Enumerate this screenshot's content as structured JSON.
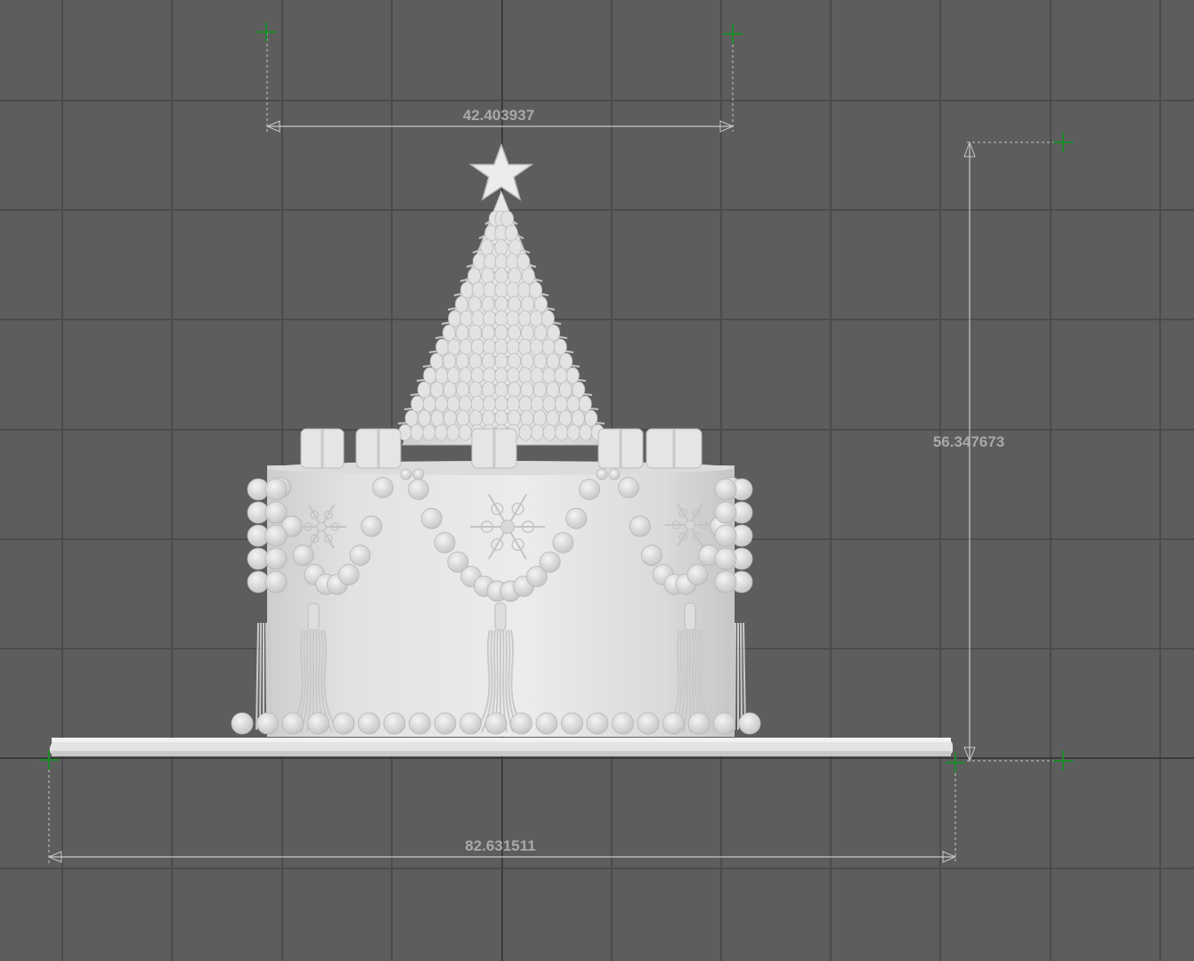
{
  "viewport": {
    "background_color": "#5d5d5d",
    "grid_line_color": "#4b4b4b",
    "axis_line_color": "#3a3a3a",
    "model_color": "#e6e6e6",
    "model_shade_color": "#cfcfcf",
    "dimension_line_color": "#c8c8c8",
    "dimension_text_color": "#a9a9a9",
    "snap_marker_color": "#1e8a2a"
  },
  "model": {
    "name": "christmas-tree-cake",
    "topper_icon": "star-icon"
  },
  "dimensions": {
    "tree_width": "42.403937",
    "cake_height": "56.347673",
    "base_width": "82.631511"
  }
}
